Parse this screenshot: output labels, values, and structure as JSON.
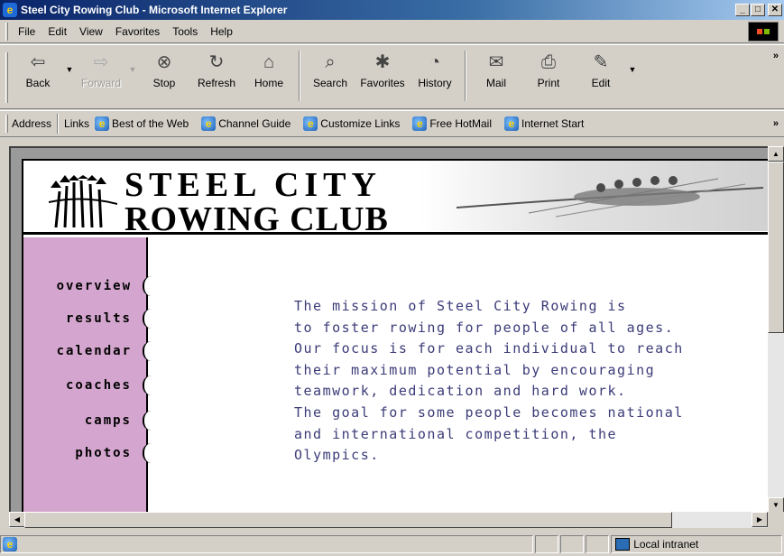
{
  "window": {
    "title": "Steel City Rowing Club - Microsoft Internet Explorer"
  },
  "menubar": {
    "items": [
      {
        "label": "File"
      },
      {
        "label": "Edit"
      },
      {
        "label": "View"
      },
      {
        "label": "Favorites"
      },
      {
        "label": "Tools"
      },
      {
        "label": "Help"
      }
    ]
  },
  "toolbar": {
    "buttons": [
      {
        "label": "Back",
        "icon": "back-arrow-icon"
      },
      {
        "label": "Forward",
        "icon": "forward-arrow-icon"
      },
      {
        "label": "Stop",
        "icon": "stop-icon"
      },
      {
        "label": "Refresh",
        "icon": "refresh-icon"
      },
      {
        "label": "Home",
        "icon": "home-icon"
      },
      {
        "label": "Search",
        "icon": "search-icon"
      },
      {
        "label": "Favorites",
        "icon": "favorites-icon"
      },
      {
        "label": "History",
        "icon": "history-icon"
      },
      {
        "label": "Mail",
        "icon": "mail-icon"
      },
      {
        "label": "Print",
        "icon": "print-icon"
      },
      {
        "label": "Edit",
        "icon": "edit-icon"
      }
    ]
  },
  "addressbar": {
    "address_label": "Address",
    "links_label": "Links",
    "links": [
      {
        "label": "Best of the Web"
      },
      {
        "label": "Channel Guide"
      },
      {
        "label": "Customize Links"
      },
      {
        "label": "Free HotMail"
      },
      {
        "label": "Internet Start"
      }
    ]
  },
  "page": {
    "club_name_line1": "STEEL CITY",
    "club_name_line2": "ROWING CLUB",
    "nav": [
      {
        "label": "overview"
      },
      {
        "label": "results"
      },
      {
        "label": "calendar"
      },
      {
        "label": "coaches"
      },
      {
        "label": "camps"
      },
      {
        "label": "photos"
      }
    ],
    "mission_lines": [
      "The mission of Steel City Rowing is",
      "to foster rowing for people of all ages.",
      "Our focus is for each individual to reach",
      "their maximum potential by encouraging",
      "teamwork, dedication and hard work.",
      "The goal for some people becomes national",
      "and international competition, the",
      "Olympics."
    ]
  },
  "statusbar": {
    "zone": "Local intranet"
  },
  "colors": {
    "sidebar": "#d4a6cf",
    "mission_text": "#3b3b78",
    "title_bar": "#0a246a"
  }
}
